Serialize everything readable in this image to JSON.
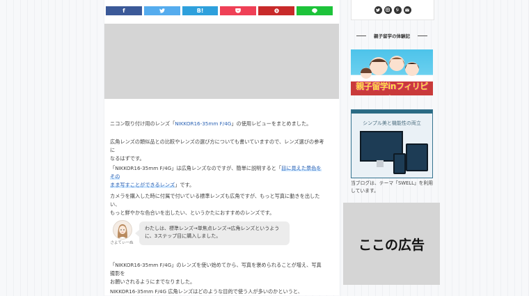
{
  "share_buttons": [
    {
      "label": "f",
      "color": "#3b5998",
      "name": "facebook"
    },
    {
      "label": "",
      "color": "#55acee",
      "name": "twitter"
    },
    {
      "label": "B!",
      "color": "#2ea0dc",
      "name": "hatena"
    },
    {
      "label": "",
      "color": "#ef4056",
      "name": "pocket"
    },
    {
      "label": "",
      "color": "#c82a2a",
      "name": "pinterest"
    },
    {
      "label": "",
      "color": "#1dc33a",
      "name": "line"
    }
  ],
  "article": {
    "p1_pre": "ニコン取り付け用のレンズ「",
    "p1_link": "NIKKOR16-35mm F/4G",
    "p1_post": "」の使用レビューをまとめました。",
    "p2_line1": "広角レンズの類似品との比較やレンズの選び方についても書いていますので、レンズ選びの参考に",
    "p2_line2": "なるはずです。",
    "p3_pre": "「NIKKOR16-35mm F/4G」は広角レンズなのですが、簡単に説明すると「",
    "p3_hl": "目に見えた景色をその",
    "p3_hl2": "まま写すことができるレンズ",
    "p3_post": "」です。",
    "p4_line1": "カメラを購入した時に付属で付いている標準レンズも広角ですが、もっと写真に動きを出したい、",
    "p4_line2": "もっと鮮やかな色合いを出したい、というかたにおすすめのレンズです。",
    "p5_line1": "「NIKKOR16-35mm F/4G」のレンズを使い始めてから、写真を褒められることが増え、写真撮影を",
    "p5_line2": "お願いされるようにまでなりました。",
    "p6": "NIKKOR16-35mm F/4G 広角レンズはどのような目的で使う人が多いのかというと、"
  },
  "speech": {
    "name": "さよてぃ一ぬ",
    "text": "わたしは、標準レンズ→単焦点レンズ→広角レンズというように、3ステップ目に購入しました。"
  },
  "sidebar": {
    "social_icons": [
      "twitter-icon",
      "instagram-icon",
      "pinterest-icon",
      "mail-icon"
    ],
    "heading": "親子留学の体験記",
    "banner_text": "親子留学inフィリピン",
    "swell_title": "シンプル美と機能性の両立",
    "caption": "当ブログは、テーマ「SWELL」を利用しています。",
    "ad_text": "ここの広告"
  }
}
